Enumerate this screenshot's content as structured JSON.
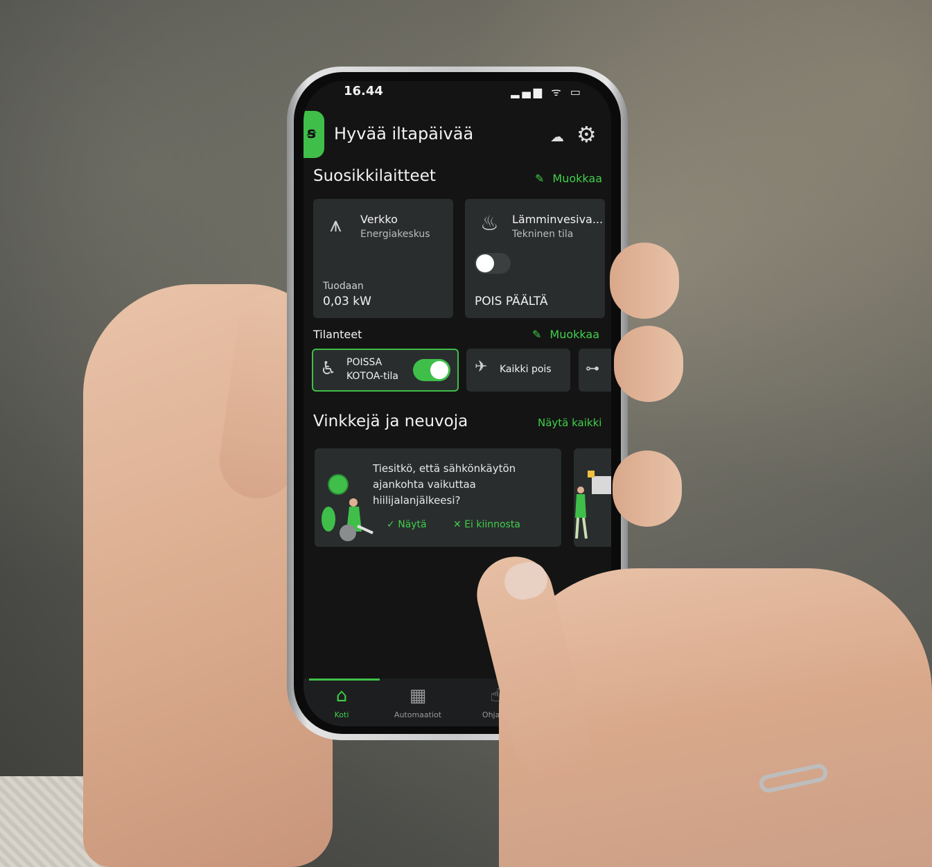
{
  "status_bar": {
    "time": "16.44",
    "icons": "▂▄▆ ᯤ ▭"
  },
  "header": {
    "greeting": "Hyvää iltapäivää"
  },
  "favorites": {
    "title": "Suosikkilaitteet",
    "edit_label": "Muokkaa",
    "cards": [
      {
        "title": "Verkko",
        "subtitle": "Energiakeskus",
        "caption": "Tuodaan",
        "value": "0,03 kW",
        "icon": "grid-tower-icon"
      },
      {
        "title": "Lämminvesiva...",
        "subtitle": "Tekninen tila",
        "value": "POIS PÄÄLTÄ",
        "icon": "water-heater-icon",
        "toggle": false
      }
    ]
  },
  "scenes": {
    "title": "Tilanteet",
    "edit_label": "Muokkaa",
    "items": [
      {
        "label_line1": "POISSA",
        "label_line2": "KOTOA-tila",
        "active": true,
        "icon": "away-person-icon"
      },
      {
        "label": "Kaikki pois",
        "icon": "airplane-icon"
      },
      {
        "label": "",
        "icon": "dumbbell-icon"
      }
    ]
  },
  "tips": {
    "title": "Vinkkejä ja neuvoja",
    "show_all": "Näytä kaikki",
    "card": {
      "text": "Tiesitkö, että sähkönkäytön ajankohta vaikuttaa hiilijalanjälkeesi?",
      "show": "Näytä",
      "dismiss": "Ei kiinnosta"
    }
  },
  "bottom_nav": [
    {
      "label": "Koti",
      "icon": "home-icon",
      "active": true
    },
    {
      "label": "Automaatiot",
      "icon": "grid-icon"
    },
    {
      "label": "Ohjaus",
      "icon": "touch-icon"
    }
  ],
  "colors": {
    "accent": "#3fbf4a",
    "card": "#2a2d2e",
    "screen": "#141414"
  }
}
